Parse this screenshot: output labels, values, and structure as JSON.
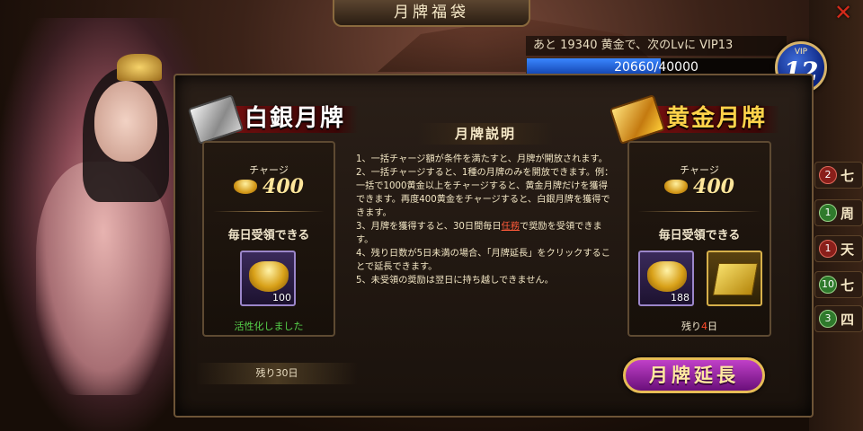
{
  "window": {
    "title": "月牌福袋",
    "close_icon": "close-icon"
  },
  "vip": {
    "progress_label": "あと  19340  黄金で、次のLvに  VIP13",
    "progress_current": 20660,
    "progress_max": 40000,
    "progress_text": "20660/40000",
    "badge_label": "VIP",
    "level": "12"
  },
  "sidebar": {
    "items": [
      {
        "badge": "2",
        "label": "七",
        "color": "#8a1f1a"
      },
      {
        "badge": "1",
        "label": "周",
        "color": "#2f7a2c"
      },
      {
        "badge": "1",
        "label": "天",
        "color": "#8a1f1a"
      },
      {
        "badge": "10",
        "label": "七",
        "color": "#2f7a2c"
      },
      {
        "badge": "3",
        "label": "四",
        "color": "#2f7a2c"
      }
    ]
  },
  "silver": {
    "title": "白銀月牌",
    "charge_label": "チャージ",
    "price": "400",
    "daily_label": "毎日受領できる",
    "reward_count": "100",
    "status": "活性化しました",
    "remaining": "残り30日"
  },
  "gold": {
    "title": "黄金月牌",
    "charge_label": "チャージ",
    "price": "400",
    "daily_label": "毎日受領できる",
    "reward_count": "188",
    "remaining_prefix": "残り",
    "remaining_days": "4",
    "remaining_suffix": "日"
  },
  "description": {
    "title": "月牌説明",
    "lines": [
      "1、一括チャージ額が条件を満たすと、月牌が開放されます。",
      "2、一括チャージすると、1種の月牌のみを開放できます。例：一括で1000黄金以上をチャージすると、黄金月牌だけを獲得できます。再度400黄金をチャージすると、白銀月牌を獲得できます。",
      "3、月牌を獲得すると、30日間毎日",
      "任務",
      "で奨励を受領できます。",
      "4、残り日数が5日未満の場合、「月牌延長」をクリックすることで延長できます。",
      "5、未受領の奨励は翌日に持ち越しできません。"
    ]
  },
  "extend_button": {
    "label": "月牌延長"
  },
  "colors": {
    "accent_gold": "#ffd34a",
    "vip_bar": "#3a86ff",
    "active_green": "#56d24a",
    "link_red": "#ff5a3a"
  }
}
